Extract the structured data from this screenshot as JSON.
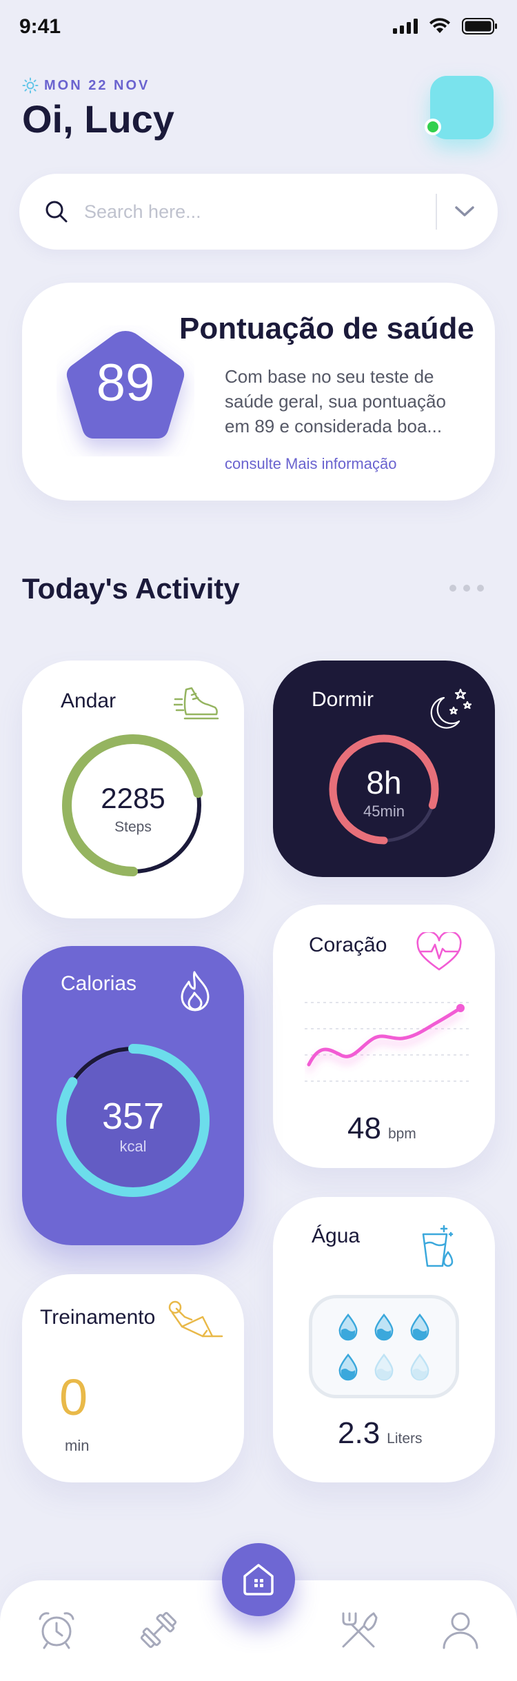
{
  "status_bar": {
    "time": "9:41"
  },
  "header": {
    "date": "MON 22 NOV",
    "greeting": "Oi, Lucy"
  },
  "search": {
    "placeholder": "Search here..."
  },
  "health": {
    "title": "Pontuação de saúde",
    "score": "89",
    "description": "Com base no seu teste de saúde geral, sua pontuação em 89 e considerada boa...",
    "link": "consulte Mais informação"
  },
  "activity": {
    "title": "Today's Activity",
    "walk": {
      "label": "Andar",
      "value": "2285",
      "unit": "Steps",
      "progress": 0.72
    },
    "sleep": {
      "label": "Dormir",
      "value": "8h",
      "unit": "45min",
      "progress": 0.8
    },
    "heart": {
      "label": "Coração",
      "value": "48",
      "unit": "bpm"
    },
    "calories": {
      "label": "Calorias",
      "value": "357",
      "unit": "kcal",
      "progress": 0.84
    },
    "water": {
      "label": "Água",
      "value": "2.3",
      "unit": "Liters",
      "filled_drops": 4,
      "total_drops": 6
    },
    "training": {
      "label": "Treinamento",
      "value": "0",
      "unit": "min"
    }
  },
  "colors": {
    "accent": "#6E67D3",
    "walk": "#95B460",
    "sleep": "#E8707A",
    "heart": "#F25CD4",
    "calories": "#6CDDEB",
    "water": "#3BA8DC",
    "training": "#E9B949"
  },
  "nav": {
    "items": [
      "alarm-icon",
      "dumbbell-icon",
      "home-icon",
      "cutlery-icon",
      "profile-icon"
    ]
  }
}
